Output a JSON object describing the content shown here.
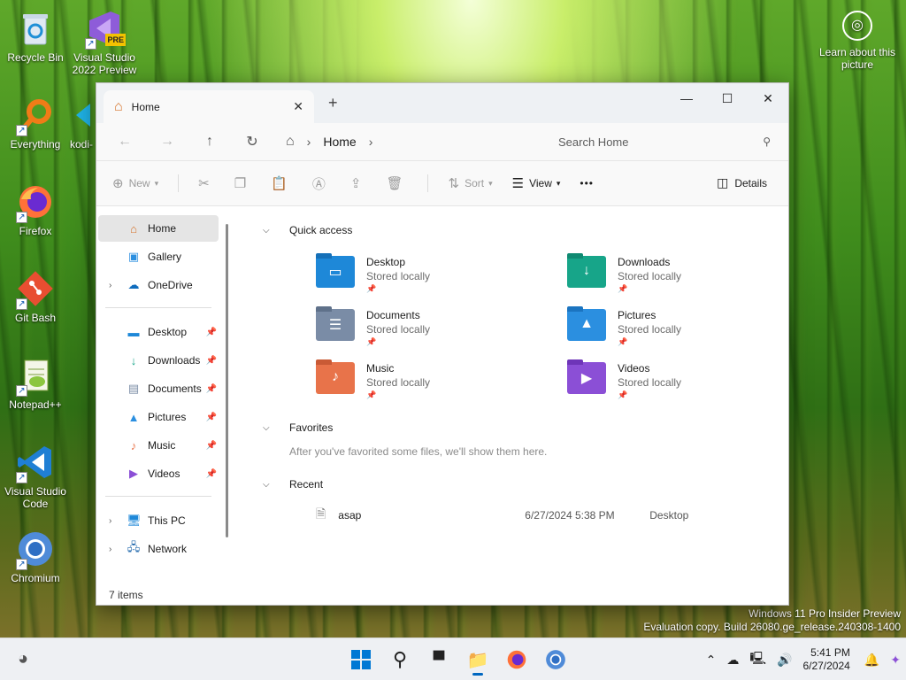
{
  "desktop": {
    "icons": [
      {
        "label": "Recycle Bin"
      },
      {
        "label": "Visual Studio 2022 Preview",
        "badge": "PRE"
      },
      {
        "label": "Everything"
      },
      {
        "label": "kodi-"
      },
      {
        "label": "Firefox"
      },
      {
        "label": "Git Bash"
      },
      {
        "label": "Notepad++"
      },
      {
        "label": "Visual Studio Code"
      },
      {
        "label": "Chromium"
      }
    ],
    "learn_label": "Learn about this picture",
    "watermark_line1": "Windows 11 Pro Insider Preview",
    "watermark_line2": "Evaluation copy. Build 26080.ge_release.240308-1400"
  },
  "explorer": {
    "tab_title": "Home",
    "breadcrumb": "Home",
    "search_placeholder": "Search Home",
    "toolbar": {
      "new": "New",
      "sort": "Sort",
      "view": "View",
      "more": "•••",
      "details": "Details"
    },
    "nav": {
      "top": [
        {
          "label": "Home",
          "icon": "home-icon",
          "active": true
        },
        {
          "label": "Gallery",
          "icon": "gallery-icon"
        },
        {
          "label": "OneDrive",
          "icon": "cloud-icon",
          "expandable": true
        }
      ],
      "pinned": [
        {
          "label": "Desktop",
          "icon": "desktop-icon"
        },
        {
          "label": "Downloads",
          "icon": "download-icon"
        },
        {
          "label": "Documents",
          "icon": "document-icon"
        },
        {
          "label": "Pictures",
          "icon": "picture-icon"
        },
        {
          "label": "Music",
          "icon": "music-icon"
        },
        {
          "label": "Videos",
          "icon": "video-icon"
        }
      ],
      "bottom": [
        {
          "label": "This PC",
          "icon": "pc-icon"
        },
        {
          "label": "Network",
          "icon": "network-icon"
        }
      ]
    },
    "status": "7 items",
    "sections": {
      "quick_access": "Quick access",
      "favorites": "Favorites",
      "favorites_empty": "After you've favorited some files, we'll show them here.",
      "recent": "Recent"
    },
    "quick_access": [
      {
        "name": "Desktop",
        "sub": "Stored locally",
        "color": "#1e88d8"
      },
      {
        "name": "Downloads",
        "sub": "Stored locally",
        "color": "#17a589"
      },
      {
        "name": "Documents",
        "sub": "Stored locally",
        "color": "#7a8ca6"
      },
      {
        "name": "Pictures",
        "sub": "Stored locally",
        "color": "#2b8fe0"
      },
      {
        "name": "Music",
        "sub": "Stored locally",
        "color": "#e8734a"
      },
      {
        "name": "Videos",
        "sub": "Stored locally",
        "color": "#8b4fd6"
      }
    ],
    "recent": [
      {
        "name": "asap",
        "date": "6/27/2024 5:38 PM",
        "location": "Desktop"
      }
    ]
  },
  "taskbar": {
    "time": "5:41 PM",
    "date": "6/27/2024"
  }
}
